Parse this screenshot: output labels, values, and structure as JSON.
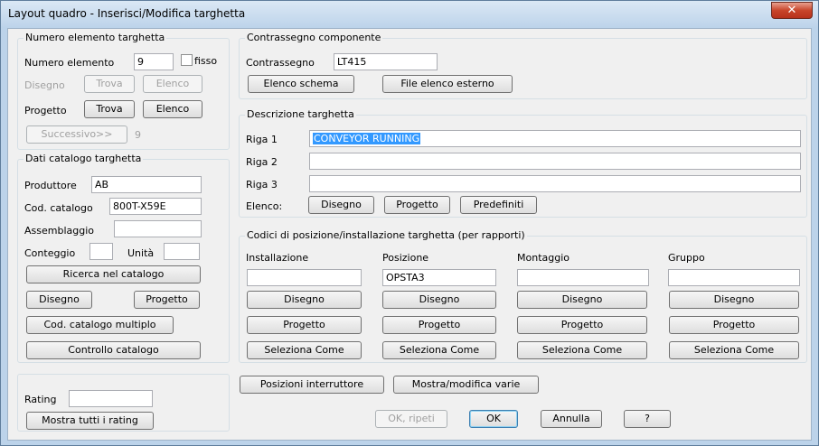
{
  "window": {
    "title": "Layout quadro - Inserisci/Modifica targhetta",
    "close_glyph": "✕"
  },
  "numero": {
    "title": "Numero elemento targhetta",
    "numero_label": "Numero elemento",
    "numero_value": "9",
    "fisso_label": "fisso",
    "disegno_label": "Disegno",
    "trova": "Trova",
    "elenco": "Elenco",
    "progetto_label": "Progetto",
    "successivo": "Successivo>>",
    "successivo_value": "9"
  },
  "catalogo": {
    "title": "Dati catalogo targhetta",
    "produttore_label": "Produttore",
    "produttore_value": "AB",
    "cod_label": "Cod. catalogo",
    "cod_value": "800T-X59E",
    "assemblaggio_label": "Assemblaggio",
    "assemblaggio_value": "",
    "conteggio_label": "Conteggio",
    "conteggio_value": "",
    "unita_label": "Unità",
    "unita_value": "",
    "ricerca": "Ricerca nel catalogo",
    "disegno": "Disegno",
    "progetto": "Progetto",
    "cod_multiplo": "Cod. catalogo multiplo",
    "controllo": "Controllo catalogo"
  },
  "rating": {
    "label": "Rating",
    "value": "",
    "mostra": "Mostra tutti i rating"
  },
  "contrassegno": {
    "title": "Contrassegno componente",
    "label": "Contrassegno",
    "value": "LT415",
    "elenco_schema": "Elenco schema",
    "file_elenco": "File elenco esterno"
  },
  "descrizione": {
    "title": "Descrizione targhetta",
    "riga1_label": "Riga 1",
    "riga1_value": "CONVEYOR RUNNING",
    "riga2_label": "Riga 2",
    "riga2_value": "",
    "riga3_label": "Riga 3",
    "riga3_value": "",
    "elenco_label": "Elenco:",
    "disegno": "Disegno",
    "progetto": "Progetto",
    "predefiniti": "Predefiniti"
  },
  "codici": {
    "title": "Codici di posizione/installazione targhetta (per rapporti)",
    "columns": [
      {
        "label": "Installazione",
        "value": ""
      },
      {
        "label": "Posizione",
        "value": "OPSTA3"
      },
      {
        "label": "Montaggio",
        "value": ""
      },
      {
        "label": "Gruppo",
        "value": ""
      }
    ],
    "disegno": "Disegno",
    "progetto": "Progetto",
    "seleziona": "Seleziona Come"
  },
  "bottom": {
    "posizioni": "Posizioni interruttore",
    "mostra_varie": "Mostra/modifica varie",
    "ok_ripeti": "OK, ripeti",
    "ok": "OK",
    "annulla": "Annulla",
    "help": "?"
  }
}
